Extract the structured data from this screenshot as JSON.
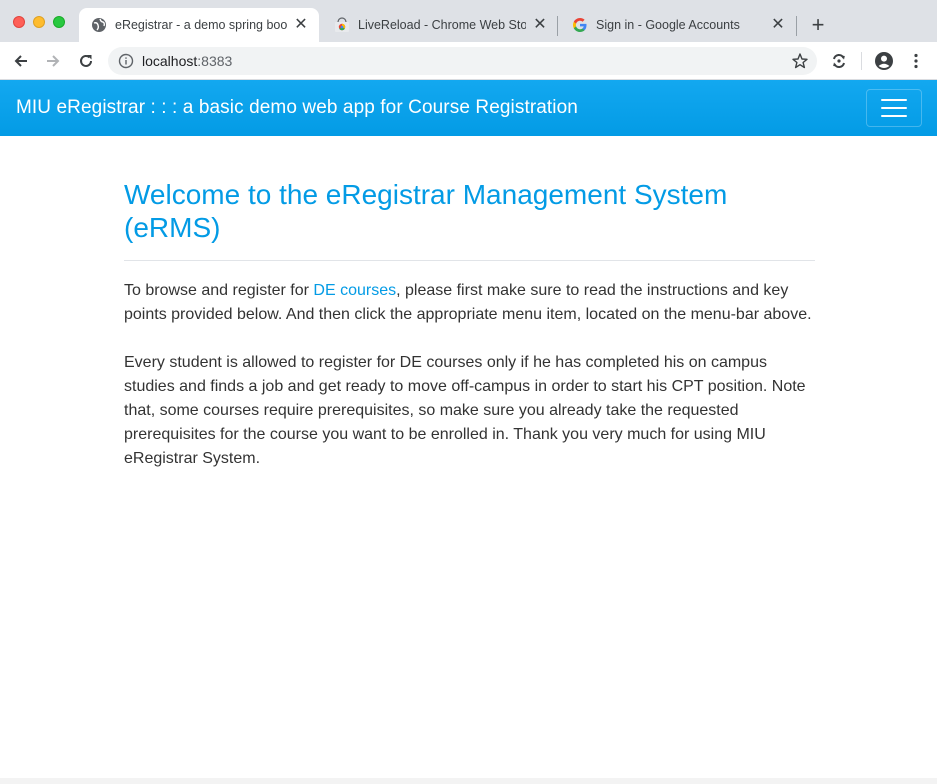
{
  "browser": {
    "tabs": [
      {
        "title": "eRegistrar - a demo spring boot",
        "favicon": "globe-icon",
        "active": true
      },
      {
        "title": "LiveReload - Chrome Web Store",
        "favicon": "chrome-webstore-icon",
        "active": false
      },
      {
        "title": "Sign in - Google Accounts",
        "favicon": "google-icon",
        "active": false
      }
    ],
    "new_tab_label": "+",
    "close_label": "✕",
    "address": {
      "host": "localhost",
      "port": ":8383"
    }
  },
  "navbar": {
    "brand": "MIU eRegistrar : : : a basic demo web app for Course Registration"
  },
  "main": {
    "heading": "Welcome to the eRegistrar Management System (eRMS)",
    "para1": {
      "before": "To browse and register for ",
      "link": "DE courses",
      "after": ", please first make sure to read the instructions and key points provided below. And then click the appropriate menu item, located on the menu-bar above."
    },
    "para2": "Every student is allowed to register for DE courses only if he has completed his on campus studies and finds a job and get ready to move off-campus in order to start his CPT position. Note that, some courses require prerequisites, so make sure you already take the requested prerequisites for the course you want to be enrolled in. Thank you very much for using MIU eRegistrar System."
  },
  "colors": {
    "accent": "#039be5",
    "navbar": "#039be5",
    "text": "#333333"
  }
}
